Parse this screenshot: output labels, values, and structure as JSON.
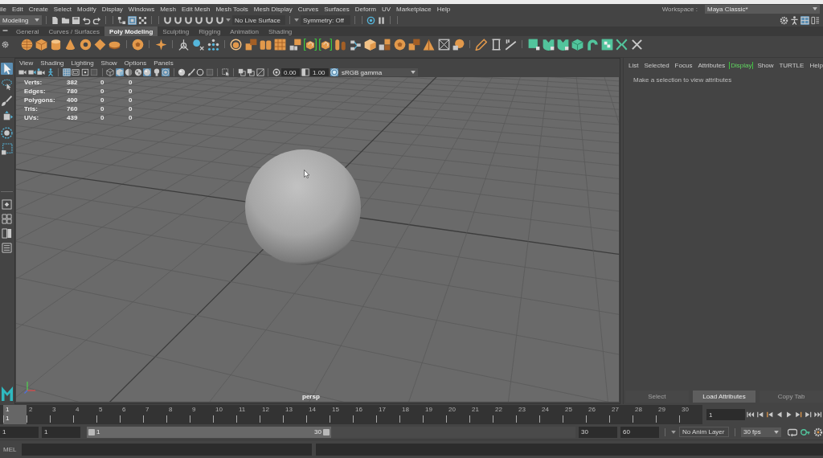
{
  "menu_bar": {
    "items": [
      "ile",
      "Edit",
      "Create",
      "Select",
      "Modify",
      "Display",
      "Windows",
      "Mesh",
      "Edit Mesh",
      "Mesh Tools",
      "Mesh Display",
      "Curves",
      "Surfaces",
      "Deform",
      "UV",
      "Marketplace",
      "Help"
    ]
  },
  "workspace": {
    "label": "Workspace :",
    "value": "Maya Classic*"
  },
  "status_line": {
    "menu_set": "Modeling",
    "selection_modes": [
      {
        "selected": false
      },
      {
        "selected": true
      },
      {
        "selected": false
      }
    ],
    "live_surface": "No Live Surface",
    "symmetry": "Symmetry: Off"
  },
  "panel_toggles": [
    {
      "selected": false
    },
    {
      "selected": false
    },
    {
      "selected": true
    },
    {
      "selected": false
    }
  ],
  "shelf": {
    "tabs": [
      {
        "label": "General",
        "selected": false
      },
      {
        "label": "Curves / Surfaces",
        "selected": false
      },
      {
        "label": "Poly Modeling",
        "selected": true
      },
      {
        "label": "Sculpting",
        "selected": false
      },
      {
        "label": "Rigging",
        "selected": false
      },
      {
        "label": "Animation",
        "selected": false
      },
      {
        "label": "Shading",
        "selected": false
      }
    ],
    "highlighted_buttons": [
      {
        "highlighted": true
      },
      {
        "highlighted": true
      }
    ]
  },
  "toolbox": {
    "tools": [
      {
        "selected": true
      },
      {
        "selected": false
      },
      {
        "selected": false
      },
      {
        "selected": false
      },
      {
        "selected": false
      },
      {
        "selected": false
      }
    ]
  },
  "viewport": {
    "menu": [
      "View",
      "Shading",
      "Lighting",
      "Show",
      "Options",
      "Panels"
    ],
    "toolbar_buttons": [
      {
        "selected": false
      },
      {
        "selected": false
      },
      {
        "selected": false
      },
      {
        "selected": false
      },
      {
        "selected": true
      },
      {
        "selected": false
      },
      {
        "selected": false
      },
      {
        "selected": false
      },
      {
        "selected": false
      },
      {
        "selected": true
      },
      {
        "selected": false
      },
      {
        "selected": false
      },
      {
        "selected": true
      },
      {
        "selected": false
      },
      {
        "selected": true
      },
      {
        "selected": false
      },
      {
        "selected": false
      },
      {
        "selected": false
      },
      {
        "selected": false
      },
      {
        "selected": false
      },
      {
        "selected": false
      },
      {
        "selected": false
      },
      {
        "selected": false
      },
      {
        "selected": false
      },
      {
        "selected": false
      },
      {
        "selected": true
      }
    ],
    "exposure": "0.00",
    "gamma": "1.00",
    "color_space": "sRGB gamma",
    "hud": [
      {
        "label": "Verts:",
        "values": [
          "382",
          "0",
          "0"
        ]
      },
      {
        "label": "Edges:",
        "values": [
          "780",
          "0",
          "0"
        ]
      },
      {
        "label": "Polygons:",
        "values": [
          "400",
          "0",
          "0"
        ]
      },
      {
        "label": "Tris:",
        "values": [
          "760",
          "0",
          "0"
        ]
      },
      {
        "label": "UVs:",
        "values": [
          "439",
          "0",
          "0"
        ]
      }
    ],
    "camera": "persp"
  },
  "attribute_editor": {
    "menu": [
      {
        "label": "List",
        "highlighted": false
      },
      {
        "label": "Selected",
        "highlighted": false
      },
      {
        "label": "Focus",
        "highlighted": false
      },
      {
        "label": "Attributes",
        "highlighted": false
      },
      {
        "label": "Display",
        "highlighted": true
      },
      {
        "label": "Show",
        "highlighted": false
      },
      {
        "label": "TURTLE",
        "highlighted": false
      },
      {
        "label": "Help",
        "highlighted": false
      }
    ],
    "message": "Make a selection to view attributes",
    "buttons": [
      {
        "label": "Select",
        "disabled": true
      },
      {
        "label": "Load Attributes",
        "disabled": false
      },
      {
        "label": "Copy Tab",
        "disabled": true
      }
    ]
  },
  "time_slider": {
    "frames": [
      {
        "label": "1",
        "selected": true
      },
      {
        "label": "2",
        "selected": false
      },
      {
        "label": "3",
        "selected": false
      },
      {
        "label": "4",
        "selected": false
      },
      {
        "label": "5",
        "selected": false
      },
      {
        "label": "6",
        "selected": false
      },
      {
        "label": "7",
        "selected": false
      },
      {
        "label": "8",
        "selected": false
      },
      {
        "label": "9",
        "selected": false
      },
      {
        "label": "10",
        "selected": false
      },
      {
        "label": "11",
        "selected": false
      },
      {
        "label": "12",
        "selected": false
      },
      {
        "label": "13",
        "selected": false
      },
      {
        "label": "14",
        "selected": false
      },
      {
        "label": "15",
        "selected": false
      },
      {
        "label": "16",
        "selected": false
      },
      {
        "label": "17",
        "selected": false
      },
      {
        "label": "18",
        "selected": false
      },
      {
        "label": "19",
        "selected": false
      },
      {
        "label": "20",
        "selected": false
      },
      {
        "label": "21",
        "selected": false
      },
      {
        "label": "22",
        "selected": false
      },
      {
        "label": "23",
        "selected": false
      },
      {
        "label": "24",
        "selected": false
      },
      {
        "label": "25",
        "selected": false
      },
      {
        "label": "26",
        "selected": false
      },
      {
        "label": "27",
        "selected": false
      },
      {
        "label": "28",
        "selected": false
      },
      {
        "label": "29",
        "selected": false
      },
      {
        "label": "30",
        "selected": false
      }
    ],
    "current_frame": "1",
    "frame_field": "1"
  },
  "range_slider": {
    "start_field": "1",
    "playback_start_field": "1",
    "range_start": "1",
    "range_end": "30",
    "level": 0.5,
    "playback_end_field": "30",
    "end_field": "60",
    "anim_layer": "No Anim Layer",
    "fps": "30 fps"
  },
  "command_line": {
    "language": "MEL"
  }
}
